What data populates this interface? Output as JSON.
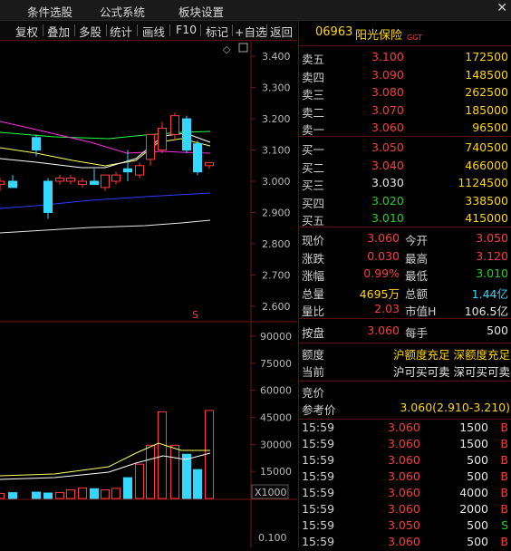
{
  "menu": {
    "items": [
      "条件选股",
      "公式系统",
      "板块设置"
    ],
    "close": "✕"
  },
  "toolbar": {
    "buttons": [
      "复权",
      "叠加",
      "多股",
      "统计",
      "画线",
      "F10",
      "标记",
      "+自选",
      "返回"
    ]
  },
  "chart": {
    "price_axis": [
      "3.400",
      "3.300",
      "3.200",
      "3.100",
      "3.000",
      "2.900",
      "2.800",
      "2.700",
      "2.600"
    ],
    "volume_axis": [
      "90000",
      "75000",
      "60000",
      "45000",
      "30000",
      "15000"
    ],
    "volume_unit": "X1000",
    "bottom_axis": "0.100",
    "marker": "S",
    "diamond": "◇"
  },
  "chart_data": {
    "type": "candlestick",
    "price_ylim": [
      2.55,
      3.45
    ],
    "candles": [
      {
        "o": 2.99,
        "h": 3.01,
        "l": 2.97,
        "c": 3.0
      },
      {
        "o": 3.0,
        "h": 3.02,
        "l": 2.98,
        "c": 2.98
      },
      {
        "o": 3.14,
        "h": 3.15,
        "l": 3.08,
        "c": 3.1
      },
      {
        "o": 3.0,
        "h": 3.01,
        "l": 2.88,
        "c": 2.9
      },
      {
        "o": 3.0,
        "h": 3.02,
        "l": 2.99,
        "c": 3.01
      },
      {
        "o": 3.0,
        "h": 3.02,
        "l": 2.99,
        "c": 3.01
      },
      {
        "o": 2.99,
        "h": 3.01,
        "l": 2.98,
        "c": 3.0
      },
      {
        "o": 3.0,
        "h": 3.04,
        "l": 2.99,
        "c": 2.99
      },
      {
        "o": 2.98,
        "h": 3.02,
        "l": 2.97,
        "c": 3.02
      },
      {
        "o": 3.0,
        "h": 3.03,
        "l": 2.99,
        "c": 3.02
      },
      {
        "o": 3.04,
        "h": 3.1,
        "l": 3.0,
        "c": 3.03
      },
      {
        "o": 3.02,
        "h": 3.06,
        "l": 3.01,
        "c": 3.05
      },
      {
        "o": 3.07,
        "h": 3.15,
        "l": 3.05,
        "c": 3.15
      },
      {
        "o": 3.1,
        "h": 3.19,
        "l": 3.09,
        "c": 3.17
      },
      {
        "o": 3.15,
        "h": 3.22,
        "l": 3.13,
        "c": 3.21
      },
      {
        "o": 3.2,
        "h": 3.21,
        "l": 3.09,
        "c": 3.1
      },
      {
        "o": 3.12,
        "h": 3.13,
        "l": 3.02,
        "c": 3.03
      },
      {
        "o": 3.05,
        "h": 3.06,
        "l": 3.04,
        "c": 3.06
      }
    ],
    "volumes": [
      2.8,
      3.2,
      3.5,
      3.0,
      3.3,
      4.8,
      5.8,
      5.4,
      4.8,
      5.6,
      11.5,
      19.0,
      29.5,
      48.0,
      29.5,
      24.5,
      16.0,
      48.8
    ],
    "volume_unit": "X1000",
    "volume_ylim": [
      0,
      97000
    ]
  },
  "quote": {
    "code": "06963",
    "name": "阳光保险",
    "tag": "GGT",
    "asks": [
      {
        "label": "卖五",
        "price": "3.100",
        "vol": "172500"
      },
      {
        "label": "卖四",
        "price": "3.090",
        "vol": "148500"
      },
      {
        "label": "卖三",
        "price": "3.080",
        "vol": "262500"
      },
      {
        "label": "卖二",
        "price": "3.070",
        "vol": "185000"
      },
      {
        "label": "卖一",
        "price": "3.060",
        "vol": "96500"
      }
    ],
    "bids": [
      {
        "label": "买一",
        "price": "3.050",
        "vol": "740500",
        "color": "#ff3b3b"
      },
      {
        "label": "买二",
        "price": "3.040",
        "vol": "466000",
        "color": "#ff3b3b"
      },
      {
        "label": "买三",
        "price": "3.030",
        "vol": "1124500",
        "color": "#e6e6e6"
      },
      {
        "label": "买四",
        "price": "3.020",
        "vol": "338500",
        "color": "#22d222"
      },
      {
        "label": "买五",
        "price": "3.010",
        "vol": "415000",
        "color": "#22d222"
      }
    ],
    "stats": [
      {
        "l1": "现价",
        "v1": "3.060",
        "c1": "#ff3b3b",
        "l2": "今开",
        "v2": "3.050",
        "c2": "#ff3b3b"
      },
      {
        "l1": "涨跌",
        "v1": "0.030",
        "c1": "#ff3b3b",
        "l2": "最高",
        "v2": "3.120",
        "c2": "#ff3b3b"
      },
      {
        "l1": "涨幅",
        "v1": "0.99%",
        "c1": "#ff3b3b",
        "l2": "最低",
        "v2": "3.010",
        "c2": "#22d222"
      },
      {
        "l1": "总量",
        "v1": "4695万",
        "c1": "#ffd700",
        "l2": "总额",
        "v2": "1.44亿",
        "c2": "#33d7ff"
      },
      {
        "l1": "量比",
        "v1": "2.03",
        "c1": "#ff3b3b",
        "l2": "市值H",
        "v2": "106.5亿",
        "c2": "#e6e6e6"
      }
    ],
    "lot": {
      "l1": "按盘",
      "v1": "3.060",
      "l2": "每手",
      "v2": "500"
    },
    "quota": {
      "label": "额度",
      "text": "沪额度充足 深额度充足"
    },
    "current": {
      "label": "当前",
      "text": "沪可买可卖 深可买可卖"
    },
    "auction": {
      "label": "竞价"
    },
    "ref": {
      "label": "参考价",
      "text": "3.060(2.910-3.210)"
    },
    "ticks": [
      {
        "time": "15:59",
        "price": "3.060",
        "pc": "#ff3b3b",
        "vol": "1500",
        "side": "B",
        "sc": "#ff3b3b"
      },
      {
        "time": "15:59",
        "price": "3.060",
        "pc": "#ff3b3b",
        "vol": "1500",
        "side": "B",
        "sc": "#ff3b3b"
      },
      {
        "time": "15:59",
        "price": "3.060",
        "pc": "#ff3b3b",
        "vol": "500",
        "side": "B",
        "sc": "#ff3b3b"
      },
      {
        "time": "15:59",
        "price": "3.060",
        "pc": "#ff3b3b",
        "vol": "500",
        "side": "B",
        "sc": "#ff3b3b"
      },
      {
        "time": "15:59",
        "price": "3.060",
        "pc": "#ff3b3b",
        "vol": "4000",
        "side": "B",
        "sc": "#ff3b3b"
      },
      {
        "time": "15:59",
        "price": "3.060",
        "pc": "#ff3b3b",
        "vol": "2000",
        "side": "B",
        "sc": "#ff3b3b"
      },
      {
        "time": "15:59",
        "price": "3.050",
        "pc": "#ff3b3b",
        "vol": "500",
        "side": "S",
        "sc": "#22d222"
      },
      {
        "time": "15:59",
        "price": "3.060",
        "pc": "#ff3b3b",
        "vol": "500",
        "side": "B",
        "sc": "#ff3b3b"
      }
    ]
  }
}
